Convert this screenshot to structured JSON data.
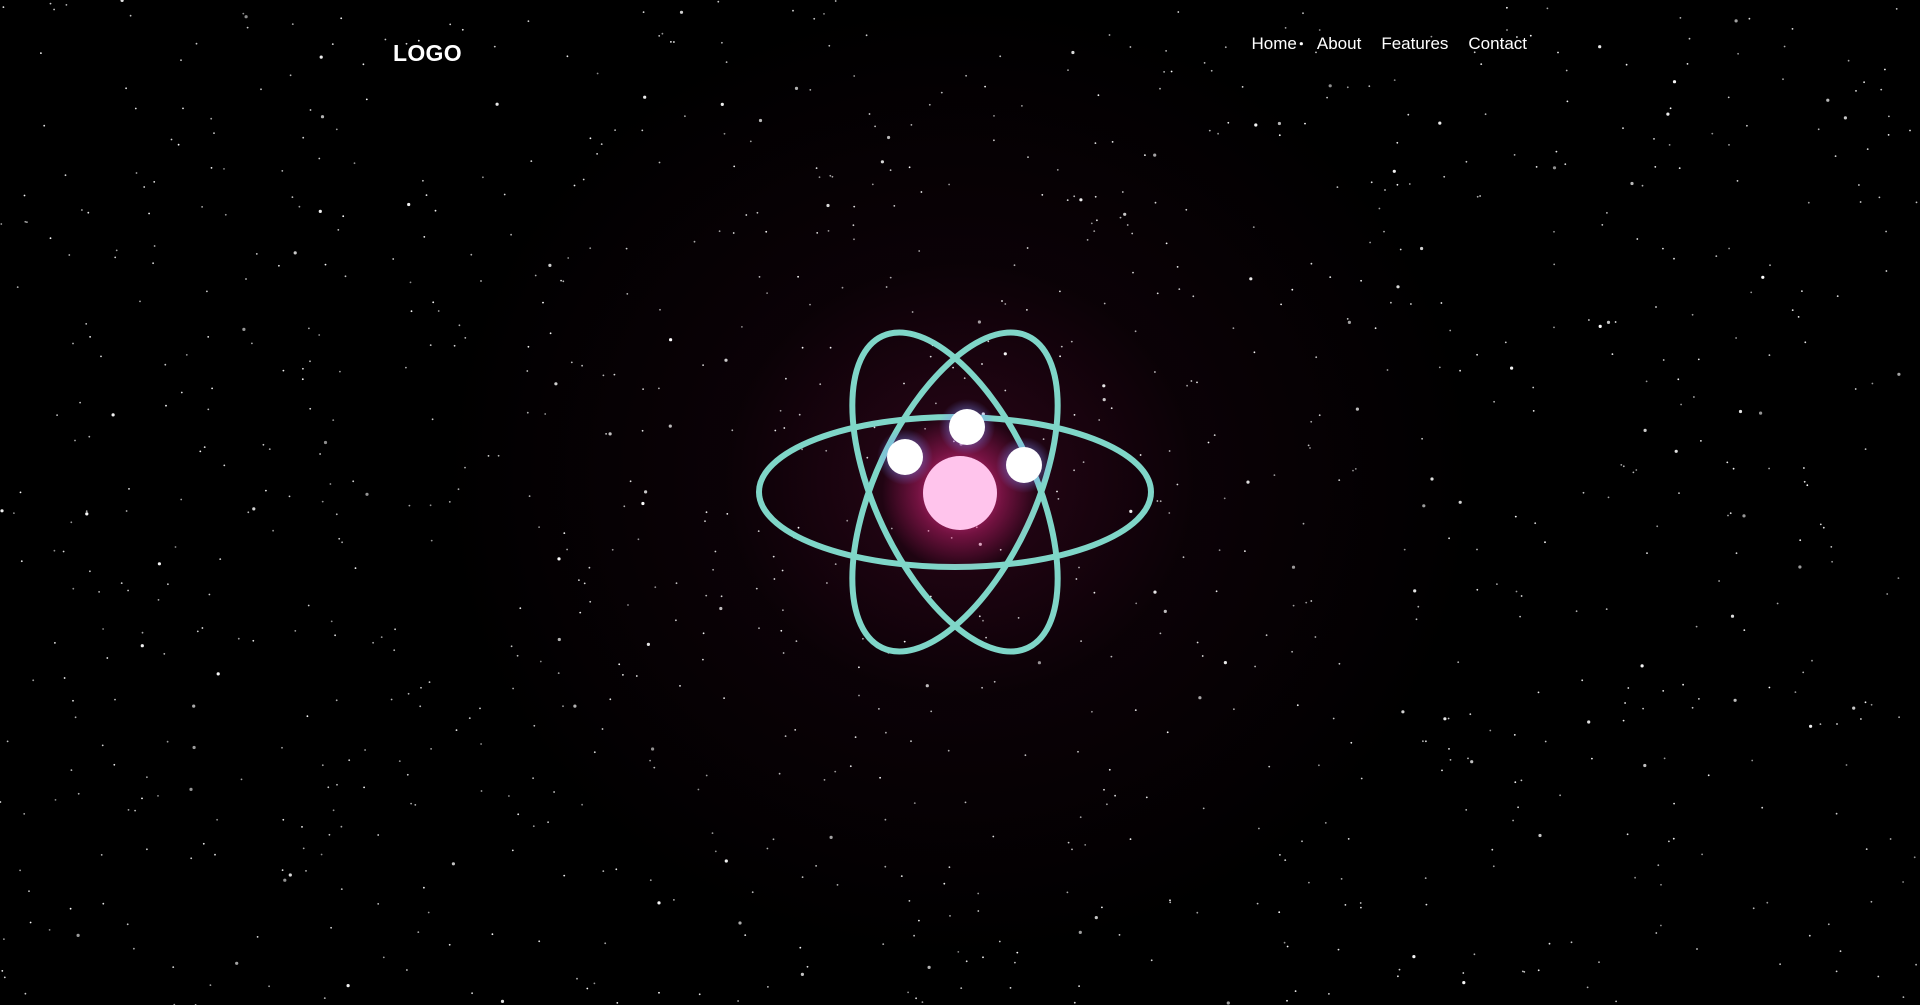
{
  "header": {
    "logo": "LOGO",
    "nav": [
      {
        "label": "Home"
      },
      {
        "label": "About"
      },
      {
        "label": "Features"
      },
      {
        "label": "Contact"
      }
    ]
  },
  "scene": {
    "background_color": "#000000",
    "orbit_color": "#7fd6c8",
    "nucleus_color": "#ffc4ec",
    "nucleus_glow_color": "#ff3aa0",
    "electron_color": "#ffffff",
    "electron_glow_color": "#8fa0ff",
    "star_color": "#ffffff",
    "electron_count": 3,
    "orbit_count": 3
  }
}
